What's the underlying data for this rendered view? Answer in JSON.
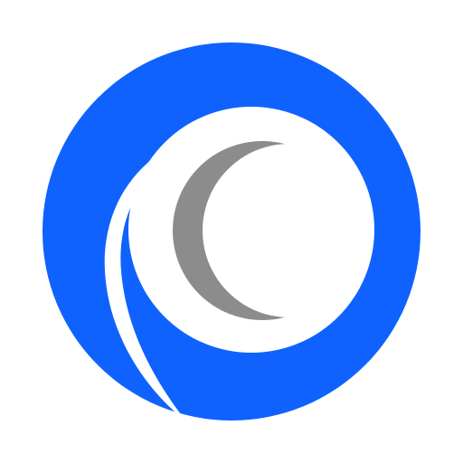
{
  "logo": {
    "icon": "swirl-logo-icon",
    "colors": {
      "primary": "#0f62fe",
      "secondary": "#8c8c8c",
      "background": "#ffffff"
    }
  }
}
